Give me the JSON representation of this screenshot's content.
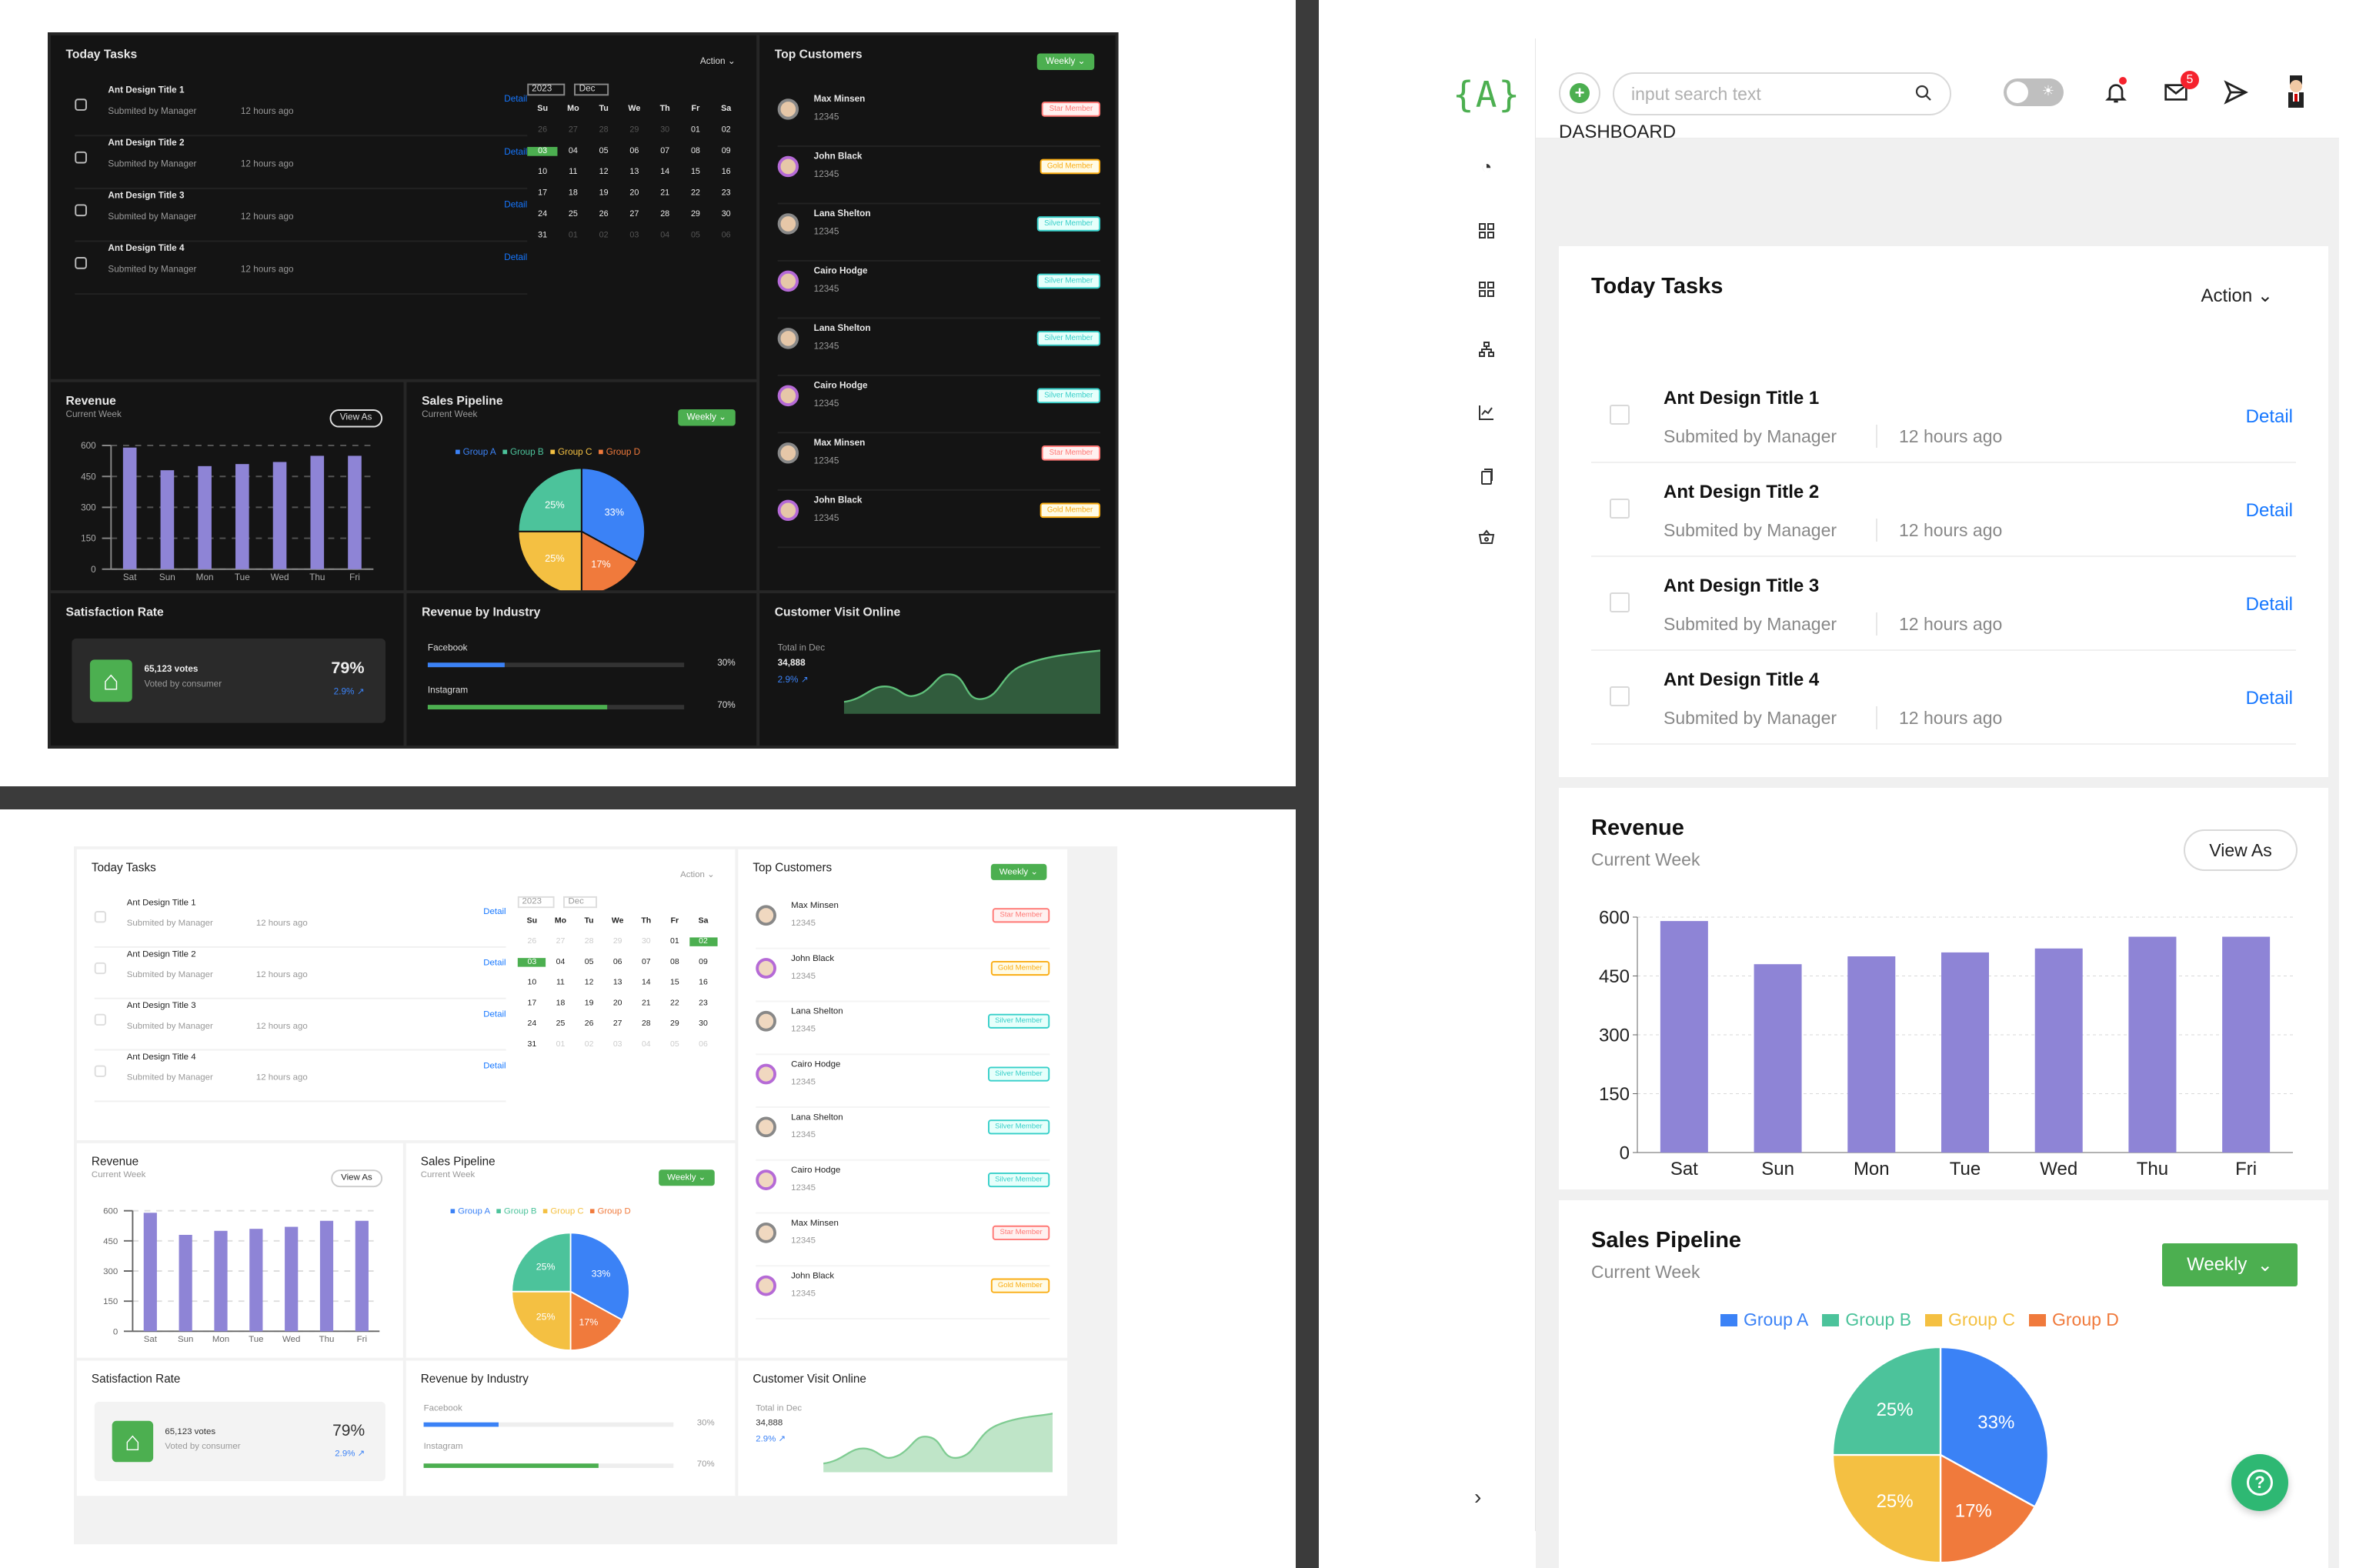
{
  "top_preview_dark": {
    "today_tasks": {
      "title": "Today Tasks",
      "action": "Action",
      "tasks": [
        {
          "title": "Ant Design Title 1",
          "submitter": "Submited by Manager",
          "time": "12 hours ago",
          "link": "Detail"
        },
        {
          "title": "Ant Design Title 2",
          "submitter": "Submited by Manager",
          "time": "12 hours ago",
          "link": "Detail"
        },
        {
          "title": "Ant Design Title 3",
          "submitter": "Submited by Manager",
          "time": "12 hours ago",
          "link": "Detail"
        },
        {
          "title": "Ant Design Title 4",
          "submitter": "Submited by Manager",
          "time": "12 hours ago",
          "link": "Detail"
        }
      ],
      "calendar": {
        "year": "2023",
        "month": "Dec",
        "weekdays": [
          "Su",
          "Mo",
          "Tu",
          "We",
          "Th",
          "Fr",
          "Sa"
        ],
        "days": [
          "26",
          "27",
          "28",
          "29",
          "30",
          "01",
          "02",
          "03",
          "04",
          "05",
          "06",
          "07",
          "08",
          "09",
          "10",
          "11",
          "12",
          "13",
          "14",
          "15",
          "16",
          "17",
          "18",
          "19",
          "20",
          "21",
          "22",
          "23",
          "24",
          "25",
          "26",
          "27",
          "28",
          "29",
          "30",
          "31",
          "01",
          "02",
          "03",
          "04",
          "05",
          "06"
        ],
        "selected": "03"
      }
    },
    "top_customers": {
      "title": "Top Customers",
      "weekly": "Weekly",
      "customers": [
        {
          "name": "Max Minsen",
          "id": "12345",
          "badge": "Star Member"
        },
        {
          "name": "John Black",
          "id": "12345",
          "badge": "Gold Member"
        },
        {
          "name": "Lana Shelton",
          "id": "12345",
          "badge": "Silver Member"
        },
        {
          "name": "Cairo Hodge",
          "id": "12345",
          "badge": "Silver Member"
        },
        {
          "name": "Lana Shelton",
          "id": "12345",
          "badge": "Silver Member"
        },
        {
          "name": "Cairo Hodge",
          "id": "12345",
          "badge": "Silver Member"
        },
        {
          "name": "Max Minsen",
          "id": "12345",
          "badge": "Star Member"
        },
        {
          "name": "John Black",
          "id": "12345",
          "badge": "Gold Member"
        }
      ]
    },
    "revenue": {
      "title": "Revenue",
      "sub": "Current Week",
      "button": "View As"
    },
    "pipeline": {
      "title": "Sales Pipeline",
      "sub": "Current Week",
      "weekly": "Weekly"
    },
    "satisfaction": {
      "title": "Satisfaction Rate",
      "votes": "65,123 votes",
      "voted_by": "Voted by consumer",
      "rate": "79%",
      "delta": "2.9% ↗"
    },
    "industry": {
      "title": "Revenue by Industry",
      "rows": [
        {
          "name": "Facebook",
          "pct": "30%",
          "value": 30
        },
        {
          "name": "Instagram",
          "pct": "70%",
          "value": 70
        }
      ]
    },
    "visits": {
      "title": "Customer Visit Online",
      "label": "Total in Dec",
      "total": "34,888",
      "delta": "2.9% ↗"
    }
  },
  "main": {
    "logo": "{A}",
    "search_placeholder": "input search text",
    "mail_count": "5",
    "page_title": "DASHBOARD",
    "today_tasks": {
      "title": "Today Tasks",
      "action": "Action",
      "tasks": [
        {
          "title": "Ant Design Title 1",
          "submitter": "Submited by Manager",
          "time": "12 hours ago",
          "link": "Detail"
        },
        {
          "title": "Ant Design Title 2",
          "submitter": "Submited by Manager",
          "time": "12 hours ago",
          "link": "Detail"
        },
        {
          "title": "Ant Design Title 3",
          "submitter": "Submited by Manager",
          "time": "12 hours ago",
          "link": "Detail"
        },
        {
          "title": "Ant Design Title 4",
          "submitter": "Submited by Manager",
          "time": "12 hours ago",
          "link": "Detail"
        }
      ]
    },
    "revenue": {
      "title": "Revenue",
      "sub": "Current Week",
      "button": "View As"
    },
    "pipeline": {
      "title": "Sales Pipeline",
      "sub": "Current Week",
      "weekly": "Weekly",
      "legend": [
        "Group A",
        "Group B",
        "Group C",
        "Group D"
      ]
    }
  },
  "chart_data": [
    {
      "type": "bar",
      "title": "Revenue",
      "categories": [
        "Sat",
        "Sun",
        "Mon",
        "Tue",
        "Wed",
        "Thu",
        "Fri"
      ],
      "values": [
        590,
        480,
        500,
        510,
        520,
        550,
        550
      ],
      "ylim": [
        0,
        600
      ],
      "yticks": [
        "0",
        "150",
        "300",
        "450",
        "600"
      ],
      "grid": true,
      "color": "#8e84d6"
    },
    {
      "type": "pie",
      "title": "Sales Pipeline",
      "series": [
        {
          "name": "Group A",
          "value": 33,
          "label": "33%",
          "color": "#3b82f6"
        },
        {
          "name": "Group D",
          "value": 17,
          "label": "17%",
          "color": "#f07a3c"
        },
        {
          "name": "Group C",
          "value": 25,
          "label": "25%",
          "color": "#f4c042"
        },
        {
          "name": "Group B",
          "value": 25,
          "label": "25%",
          "color": "#4cc39b"
        }
      ]
    }
  ]
}
